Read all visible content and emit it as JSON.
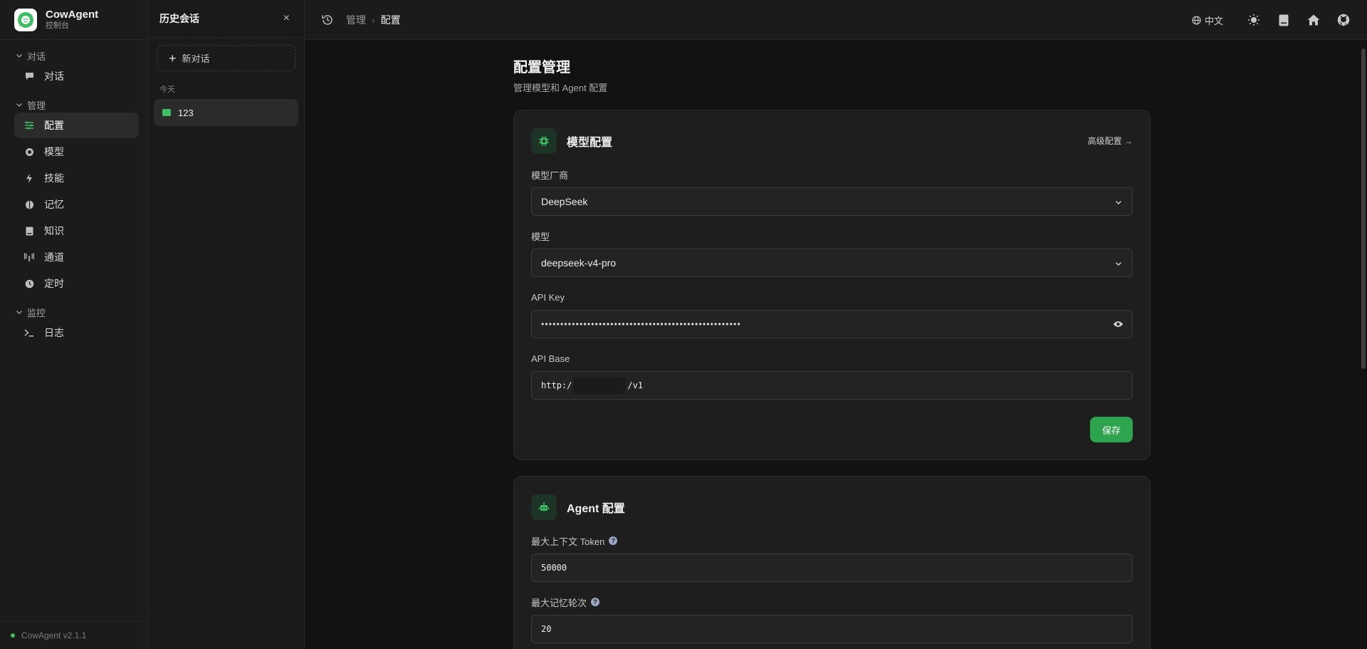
{
  "brand": {
    "name": "CowAgent",
    "subtitle": "控制台"
  },
  "nav": {
    "groups": [
      {
        "label": "对话",
        "items": [
          {
            "label": "对话",
            "icon": "chat-bubble-icon"
          }
        ]
      },
      {
        "label": "管理",
        "items": [
          {
            "label": "配置",
            "icon": "sliders-icon",
            "active": true
          },
          {
            "label": "模型",
            "icon": "chip-icon"
          },
          {
            "label": "技能",
            "icon": "bolt-icon"
          },
          {
            "label": "记忆",
            "icon": "brain-icon"
          },
          {
            "label": "知识",
            "icon": "book-icon"
          },
          {
            "label": "通道",
            "icon": "antenna-icon"
          },
          {
            "label": "定时",
            "icon": "clock-icon"
          }
        ]
      },
      {
        "label": "监控",
        "items": [
          {
            "label": "日志",
            "icon": "terminal-icon"
          }
        ]
      }
    ],
    "footer": "CowAgent v2.1.1"
  },
  "history": {
    "title": "历史会话",
    "close": "×",
    "new_chat": "新对话",
    "group_label": "今天",
    "items": [
      {
        "label": "123"
      }
    ]
  },
  "topbar": {
    "breadcrumb": [
      "管理",
      "配置"
    ],
    "breadcrumb_sep": "›",
    "language": "中文",
    "icons": [
      "history-icon",
      "globe-icon",
      "sun-icon",
      "docs-icon",
      "home-icon",
      "github-icon"
    ]
  },
  "page": {
    "title": "配置管理",
    "description": "管理模型和 Agent 配置"
  },
  "model_card": {
    "title": "模型配置",
    "advanced_link": "高级配置 →",
    "provider_label": "模型厂商",
    "provider_value": "DeepSeek",
    "model_label": "模型",
    "model_value": "deepseek-v4-pro",
    "api_key_label": "API Key",
    "api_key_value": "••••••••••••••••••••••••••••••••••••••••••••••••••••",
    "api_base_label": "API Base",
    "api_base_prefix": "http:/",
    "api_base_suffix": "/v1",
    "save": "保存"
  },
  "agent_card": {
    "title": "Agent 配置",
    "max_tokens_label": "最大上下文 Token",
    "max_tokens_value": "50000",
    "max_rounds_label": "最大记忆轮次",
    "max_rounds_value": "20"
  },
  "colors": {
    "accent": "#2ea44f",
    "brand_green": "#3cbf60",
    "background": "#121212"
  }
}
